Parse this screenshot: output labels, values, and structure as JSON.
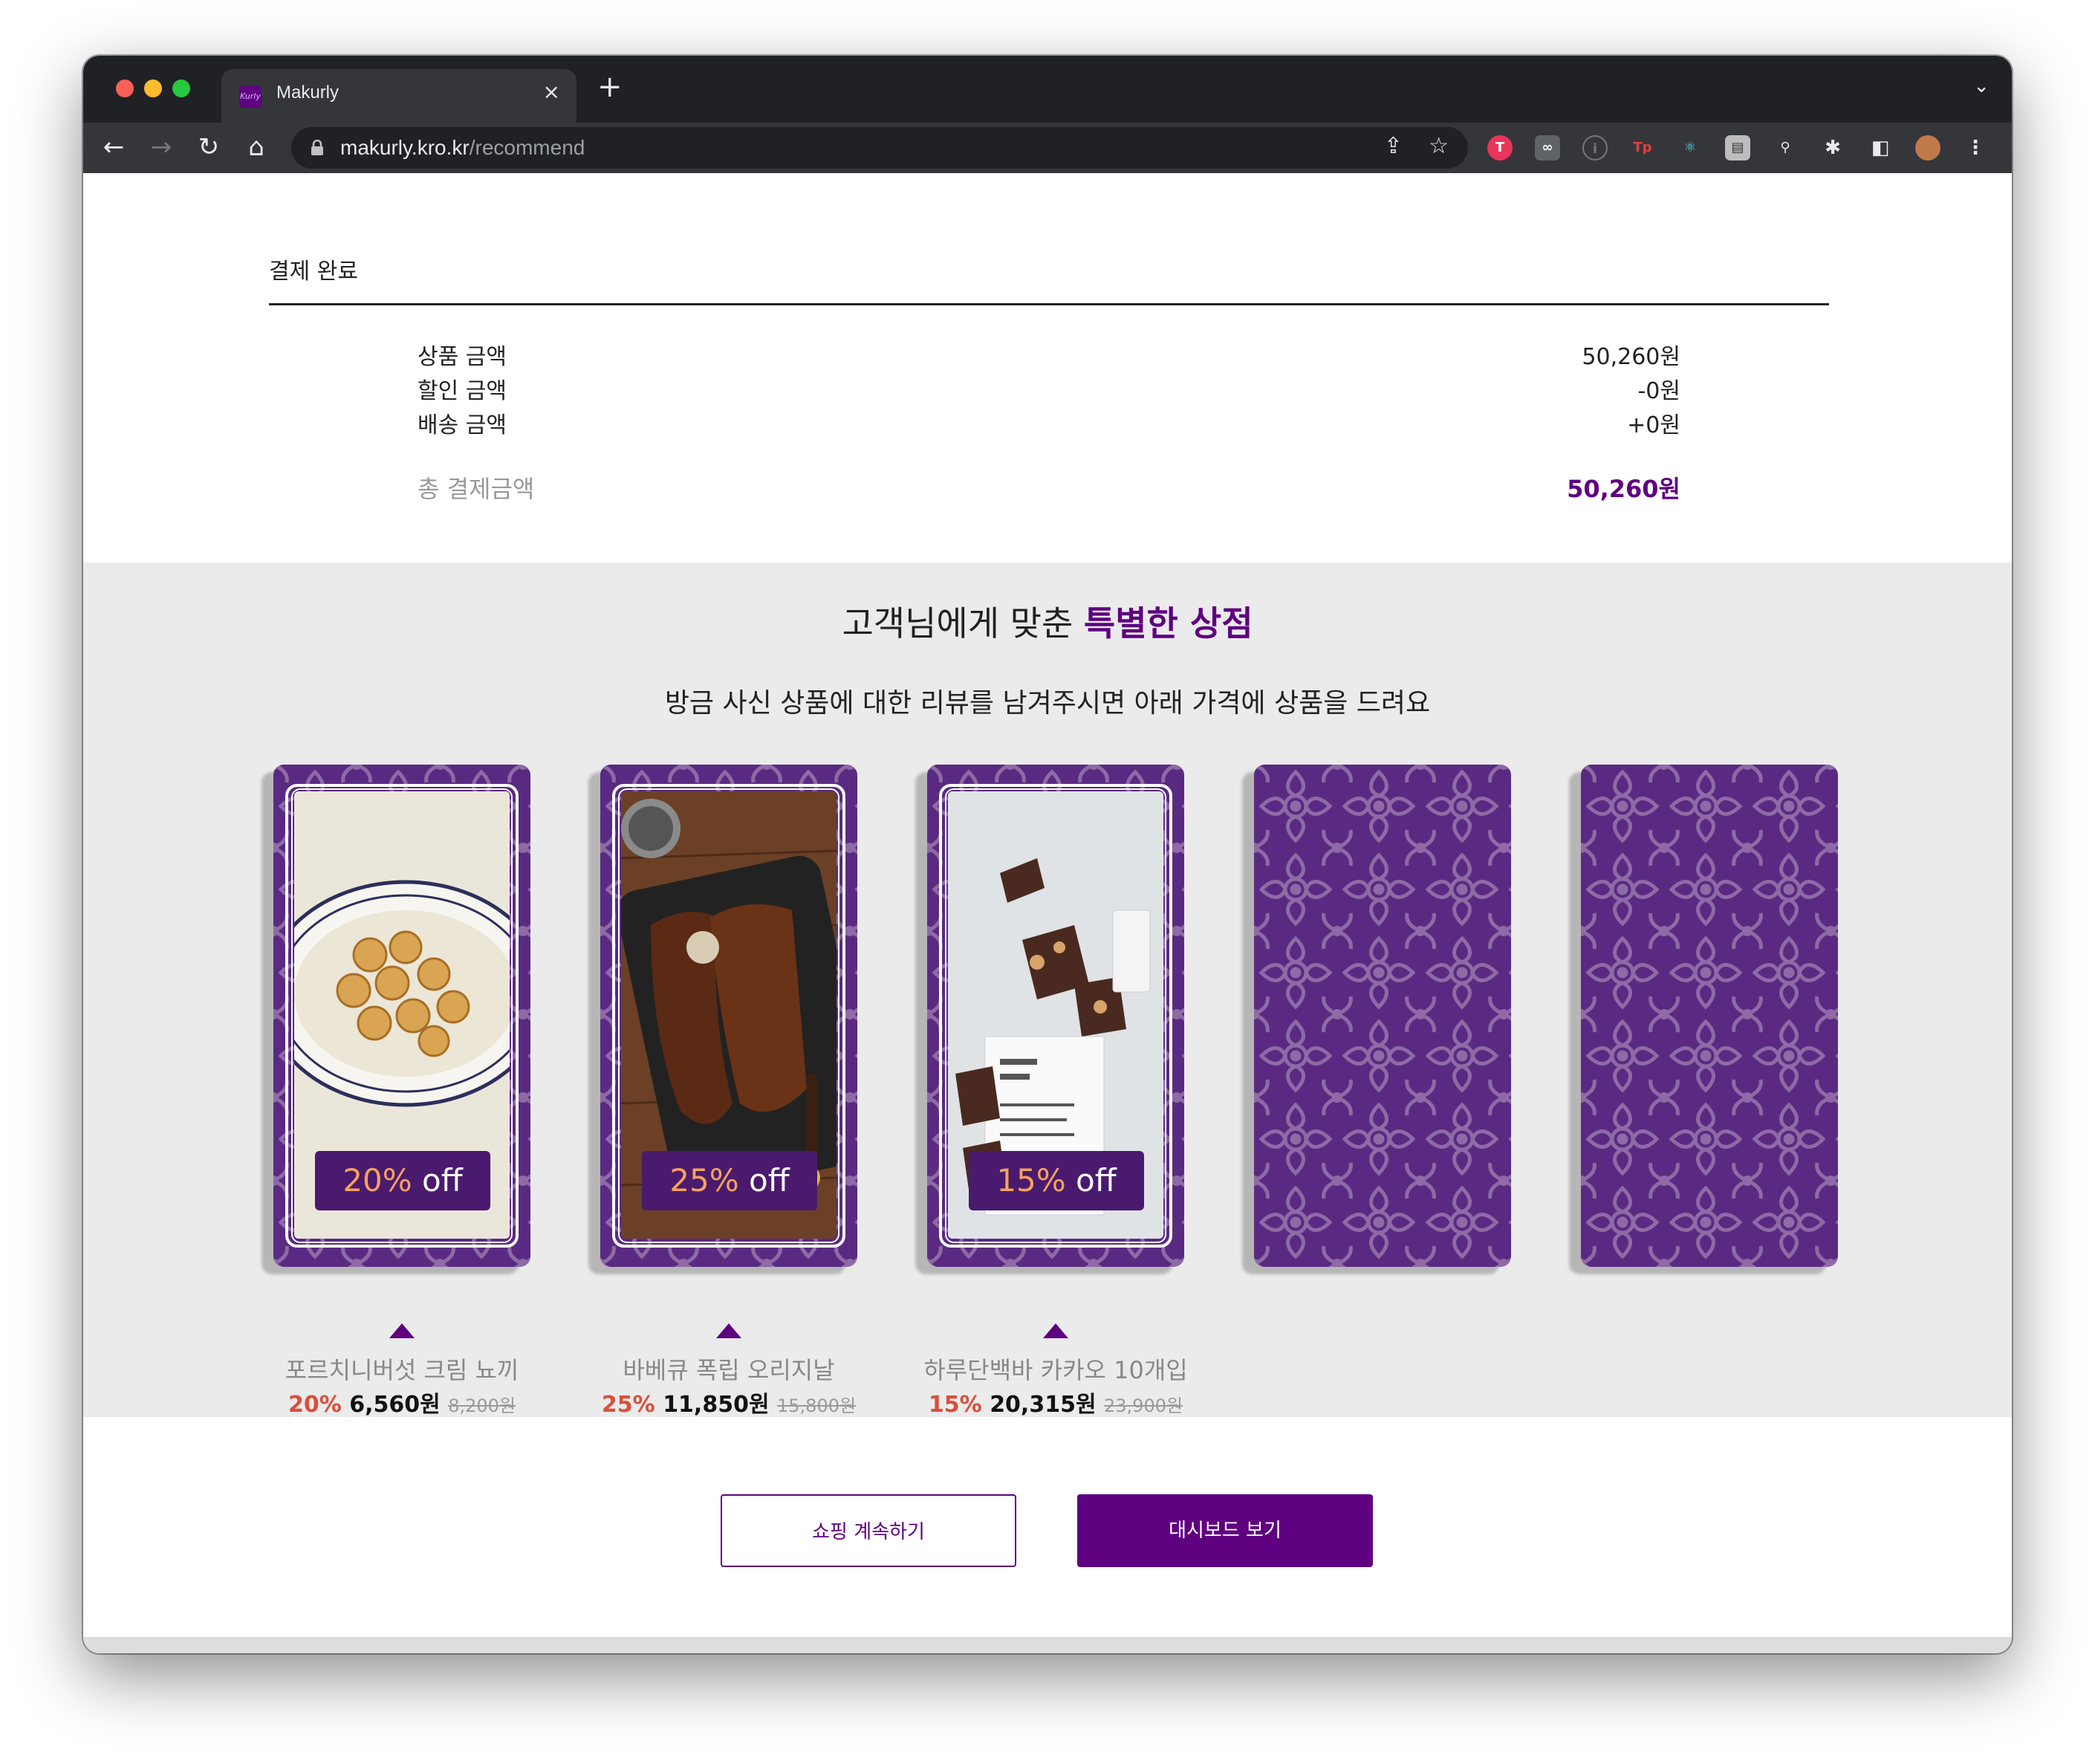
{
  "browser": {
    "tab_title": "Makurly",
    "favicon_text": "Kurly",
    "tab_close": "×",
    "new_tab": "+",
    "url_host": "makurly.kro.kr",
    "url_path": "/recommend",
    "icons": [
      "back-icon",
      "forward-icon",
      "reload-icon",
      "home-icon",
      "lock-icon",
      "share-icon",
      "bookmark-star-icon",
      "extensions-puzzle-icon",
      "side-panel-icon",
      "profile-avatar",
      "menu-kebab-icon"
    ]
  },
  "summary": {
    "title": "결제 완료",
    "rows": [
      {
        "label": "상품 금액",
        "value": "50,260원"
      },
      {
        "label": "할인 금액",
        "value": "-0원"
      },
      {
        "label": "배송 금액",
        "value": "+0원"
      }
    ],
    "total_label": "총 결제금액",
    "total_value": "50,260원",
    "accent": "#5f0080"
  },
  "recommend": {
    "title_plain": "고객님에게 맞춘 ",
    "title_accent": "특별한 상점",
    "subtitle": "방금 사신 상품에 대한 리뷰를 남겨주시면 아래 가격에 상품을 드려요",
    "cards": [
      {
        "pct": "20%",
        "off": "off",
        "name": "포르치니버섯 크림 뇨끼",
        "disc": "20%",
        "price": "6,560원",
        "orig": "8,200원",
        "photo": "gnocchi"
      },
      {
        "pct": "25%",
        "off": "off",
        "name": "바베큐 폭립 오리지날",
        "disc": "25%",
        "price": "11,850원",
        "orig": "15,800원",
        "photo": "ribs"
      },
      {
        "pct": "15%",
        "off": "off",
        "name": "하루단백바 카카오 10개입",
        "disc": "15%",
        "price": "20,315원",
        "orig": "23,900원",
        "photo": "protein-bar"
      },
      {
        "hidden": true
      },
      {
        "hidden": true
      }
    ]
  },
  "buttons": {
    "continue": "쇼핑 계속하기",
    "dashboard": "대시보드 보기"
  }
}
